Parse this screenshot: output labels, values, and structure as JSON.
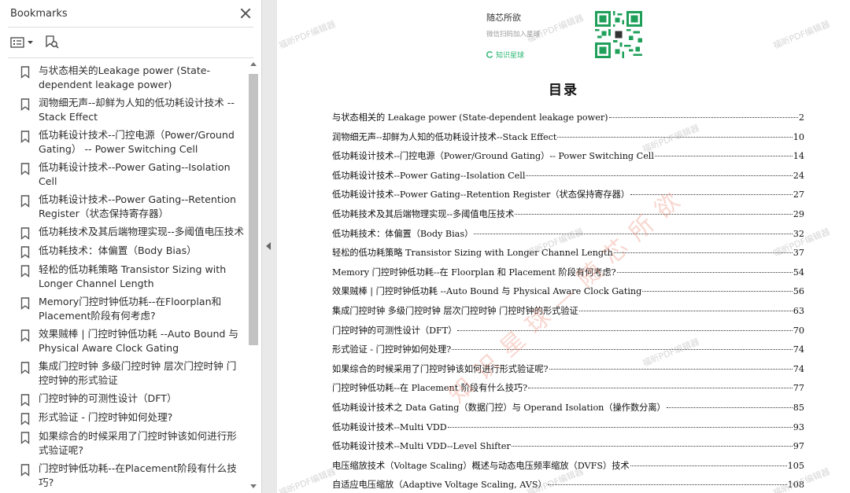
{
  "sidebar": {
    "title": "Bookmarks",
    "items": [
      {
        "label": "与状态相关的Leakage power (State-dependent leakage power)"
      },
      {
        "label": "润物细无声--却鲜为人知的低功耗设计技术 --Stack Effect"
      },
      {
        "label": "低功耗设计技术--门控电源（Power/Ground Gating） -- Power Switching Cell"
      },
      {
        "label": "低功耗设计技术--Power Gating--Isolation Cell"
      },
      {
        "label": "低功耗设计技术--Power Gating--Retention Register（状态保持寄存器）"
      },
      {
        "label": "低功耗技术及其后端物理实现--多阈值电压技术"
      },
      {
        "label": "低功耗技术：体偏置（Body Bias）"
      },
      {
        "label": "轻松的低功耗策略 Transistor Sizing with Longer Channel Length"
      },
      {
        "label": "Memory门控时钟低功耗--在Floorplan和Placement阶段有何考虑?"
      },
      {
        "label": "效果贼棒 | 门控时钟低功耗 --Auto Bound 与 Physical Aware Clock Gating"
      },
      {
        "label": "集成门控时钟 多级门控时钟 层次门控时钟 门控时钟的形式验证"
      },
      {
        "label": "门控时钟的可测性设计（DFT）"
      },
      {
        "label": "形式验证 - 门控时钟如何处理?"
      },
      {
        "label": "如果综合的时候采用了门控时钟该如何进行形式验证呢?"
      },
      {
        "label": "门控时钟低功耗--在Placement阶段有什么技巧?"
      }
    ]
  },
  "page": {
    "brand_name": "随芯所欲",
    "brand_sub": "微信扫码加入星球",
    "brand_planet": "知识星球",
    "toc_title": "目录",
    "watermark_small": "福昕PDF编辑器",
    "watermark_big": "知识星球—随芯所欲",
    "toc": [
      {
        "text": "与状态相关的 Leakage power (State-dependent leakage power)",
        "page": "2"
      },
      {
        "text": "润物细无声--却鲜为人知的低功耗设计技术--Stack Effect",
        "page": "10"
      },
      {
        "text": "低功耗设计技术--门控电源（Power/Ground Gating）-- Power Switching Cell",
        "page": "14"
      },
      {
        "text": "低功耗设计技术--Power Gating--Isolation Cell",
        "page": "24"
      },
      {
        "text": "低功耗设计技术--Power Gating--Retention Register（状态保持寄存器）",
        "page": "27"
      },
      {
        "text": "低功耗技术及其后端物理实现--多阈值电压技术",
        "page": "29"
      },
      {
        "text": "低功耗技术：体偏置（Body Bias）",
        "page": "32"
      },
      {
        "text": "轻松的低功耗策略 Transistor Sizing with Longer Channel Length",
        "page": "37"
      },
      {
        "text": "Memory 门控时钟低功耗--在 Floorplan 和 Placement 阶段有何考虑?",
        "page": "54"
      },
      {
        "text": "效果贼棒 | 门控时钟低功耗 --Auto Bound 与 Physical Aware Clock Gating",
        "page": "56"
      },
      {
        "text": "集成门控时钟 多级门控时钟 层次门控时钟 门控时钟的形式验证",
        "page": "63"
      },
      {
        "text": "门控时钟的可测性设计（DFT）",
        "page": "70"
      },
      {
        "text": "形式验证 - 门控时钟如何处理?",
        "page": "74"
      },
      {
        "text": "如果综合的时候采用了门控时钟该如何进行形式验证呢?",
        "page": "74"
      },
      {
        "text": "门控时钟低功耗--在 Placement 阶段有什么技巧?",
        "page": "77"
      },
      {
        "text": "低功耗设计技术之 Data Gating（数据门控）与 Operand Isolation（操作数分离）",
        "page": "85"
      },
      {
        "text": "低功耗设计技术--Multi VDD",
        "page": "93"
      },
      {
        "text": "低功耗设计技术--Multi VDD--Level Shifter",
        "page": "97"
      },
      {
        "text": "电压缩放技术（Voltage Scaling）概述与动态电压频率缩放（DVFS）技术",
        "page": "105"
      },
      {
        "text": "自适应电压缩放（Adaptive Voltage Scaling, AVS）",
        "page": "108"
      }
    ]
  }
}
